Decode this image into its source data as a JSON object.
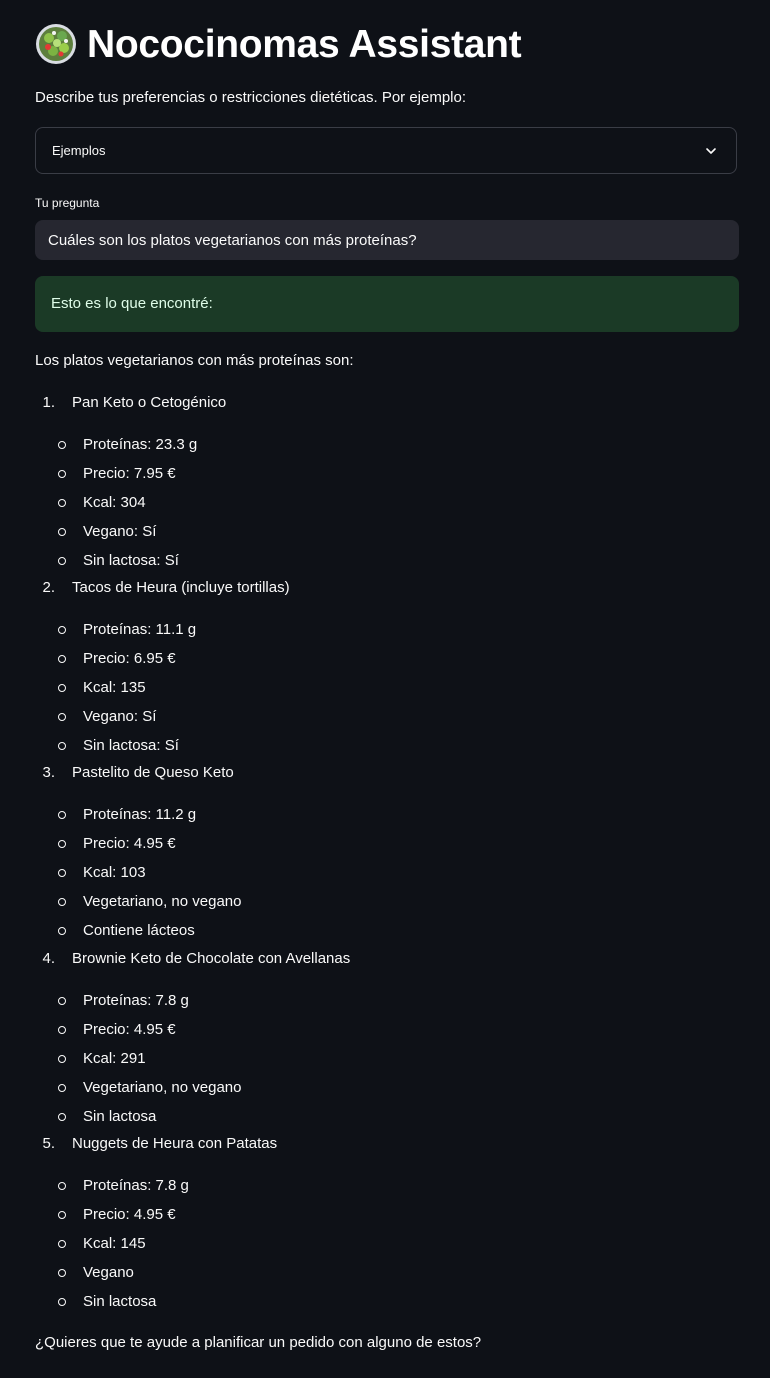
{
  "header": {
    "title": "Nococinomas Assistant",
    "logo_icon": "salad-bowl-icon"
  },
  "description": "Describe tus preferencias o restricciones dietéticas. Por ejemplo:",
  "examples_select": {
    "value": "Ejemplos"
  },
  "question": {
    "label": "Tu pregunta",
    "value": "Cuáles son los platos vegetarianos con más proteínas?"
  },
  "result": {
    "success_message": "Esto es lo que encontré:",
    "intro": "Los platos vegetarianos con más proteínas son:",
    "dishes": [
      {
        "number": "1.",
        "name": "Pan Keto o Cetogénico",
        "details": [
          "Proteínas: 23.3 g",
          "Precio: 7.95 €",
          "Kcal: 304",
          "Vegano: Sí",
          "Sin lactosa: Sí"
        ]
      },
      {
        "number": "2.",
        "name": "Tacos de Heura (incluye tortillas)",
        "details": [
          "Proteínas: 11.1 g",
          "Precio: 6.95 €",
          "Kcal: 135",
          "Vegano: Sí",
          "Sin lactosa: Sí"
        ]
      },
      {
        "number": "3.",
        "name": "Pastelito de Queso Keto",
        "details": [
          "Proteínas: 11.2 g",
          "Precio: 4.95 €",
          "Kcal: 103",
          "Vegetariano, no vegano",
          "Contiene lácteos"
        ]
      },
      {
        "number": "4.",
        "name": "Brownie Keto de Chocolate con Avellanas",
        "details": [
          "Proteínas: 7.8 g",
          "Precio: 4.95 €",
          "Kcal: 291",
          "Vegetariano, no vegano",
          "Sin lactosa"
        ]
      },
      {
        "number": "5.",
        "name": "Nuggets de Heura con Patatas",
        "details": [
          "Proteínas: 7.8 g",
          "Precio: 4.95 €",
          "Kcal: 145",
          "Vegano",
          "Sin lactosa"
        ]
      }
    ],
    "outro": "¿Quieres que te ayude a planificar un pedido con alguno de estos?"
  },
  "colors": {
    "background": "#0e1117",
    "input_background": "#262730",
    "success_background": "#1b3a26",
    "success_text": "#dffde9"
  }
}
